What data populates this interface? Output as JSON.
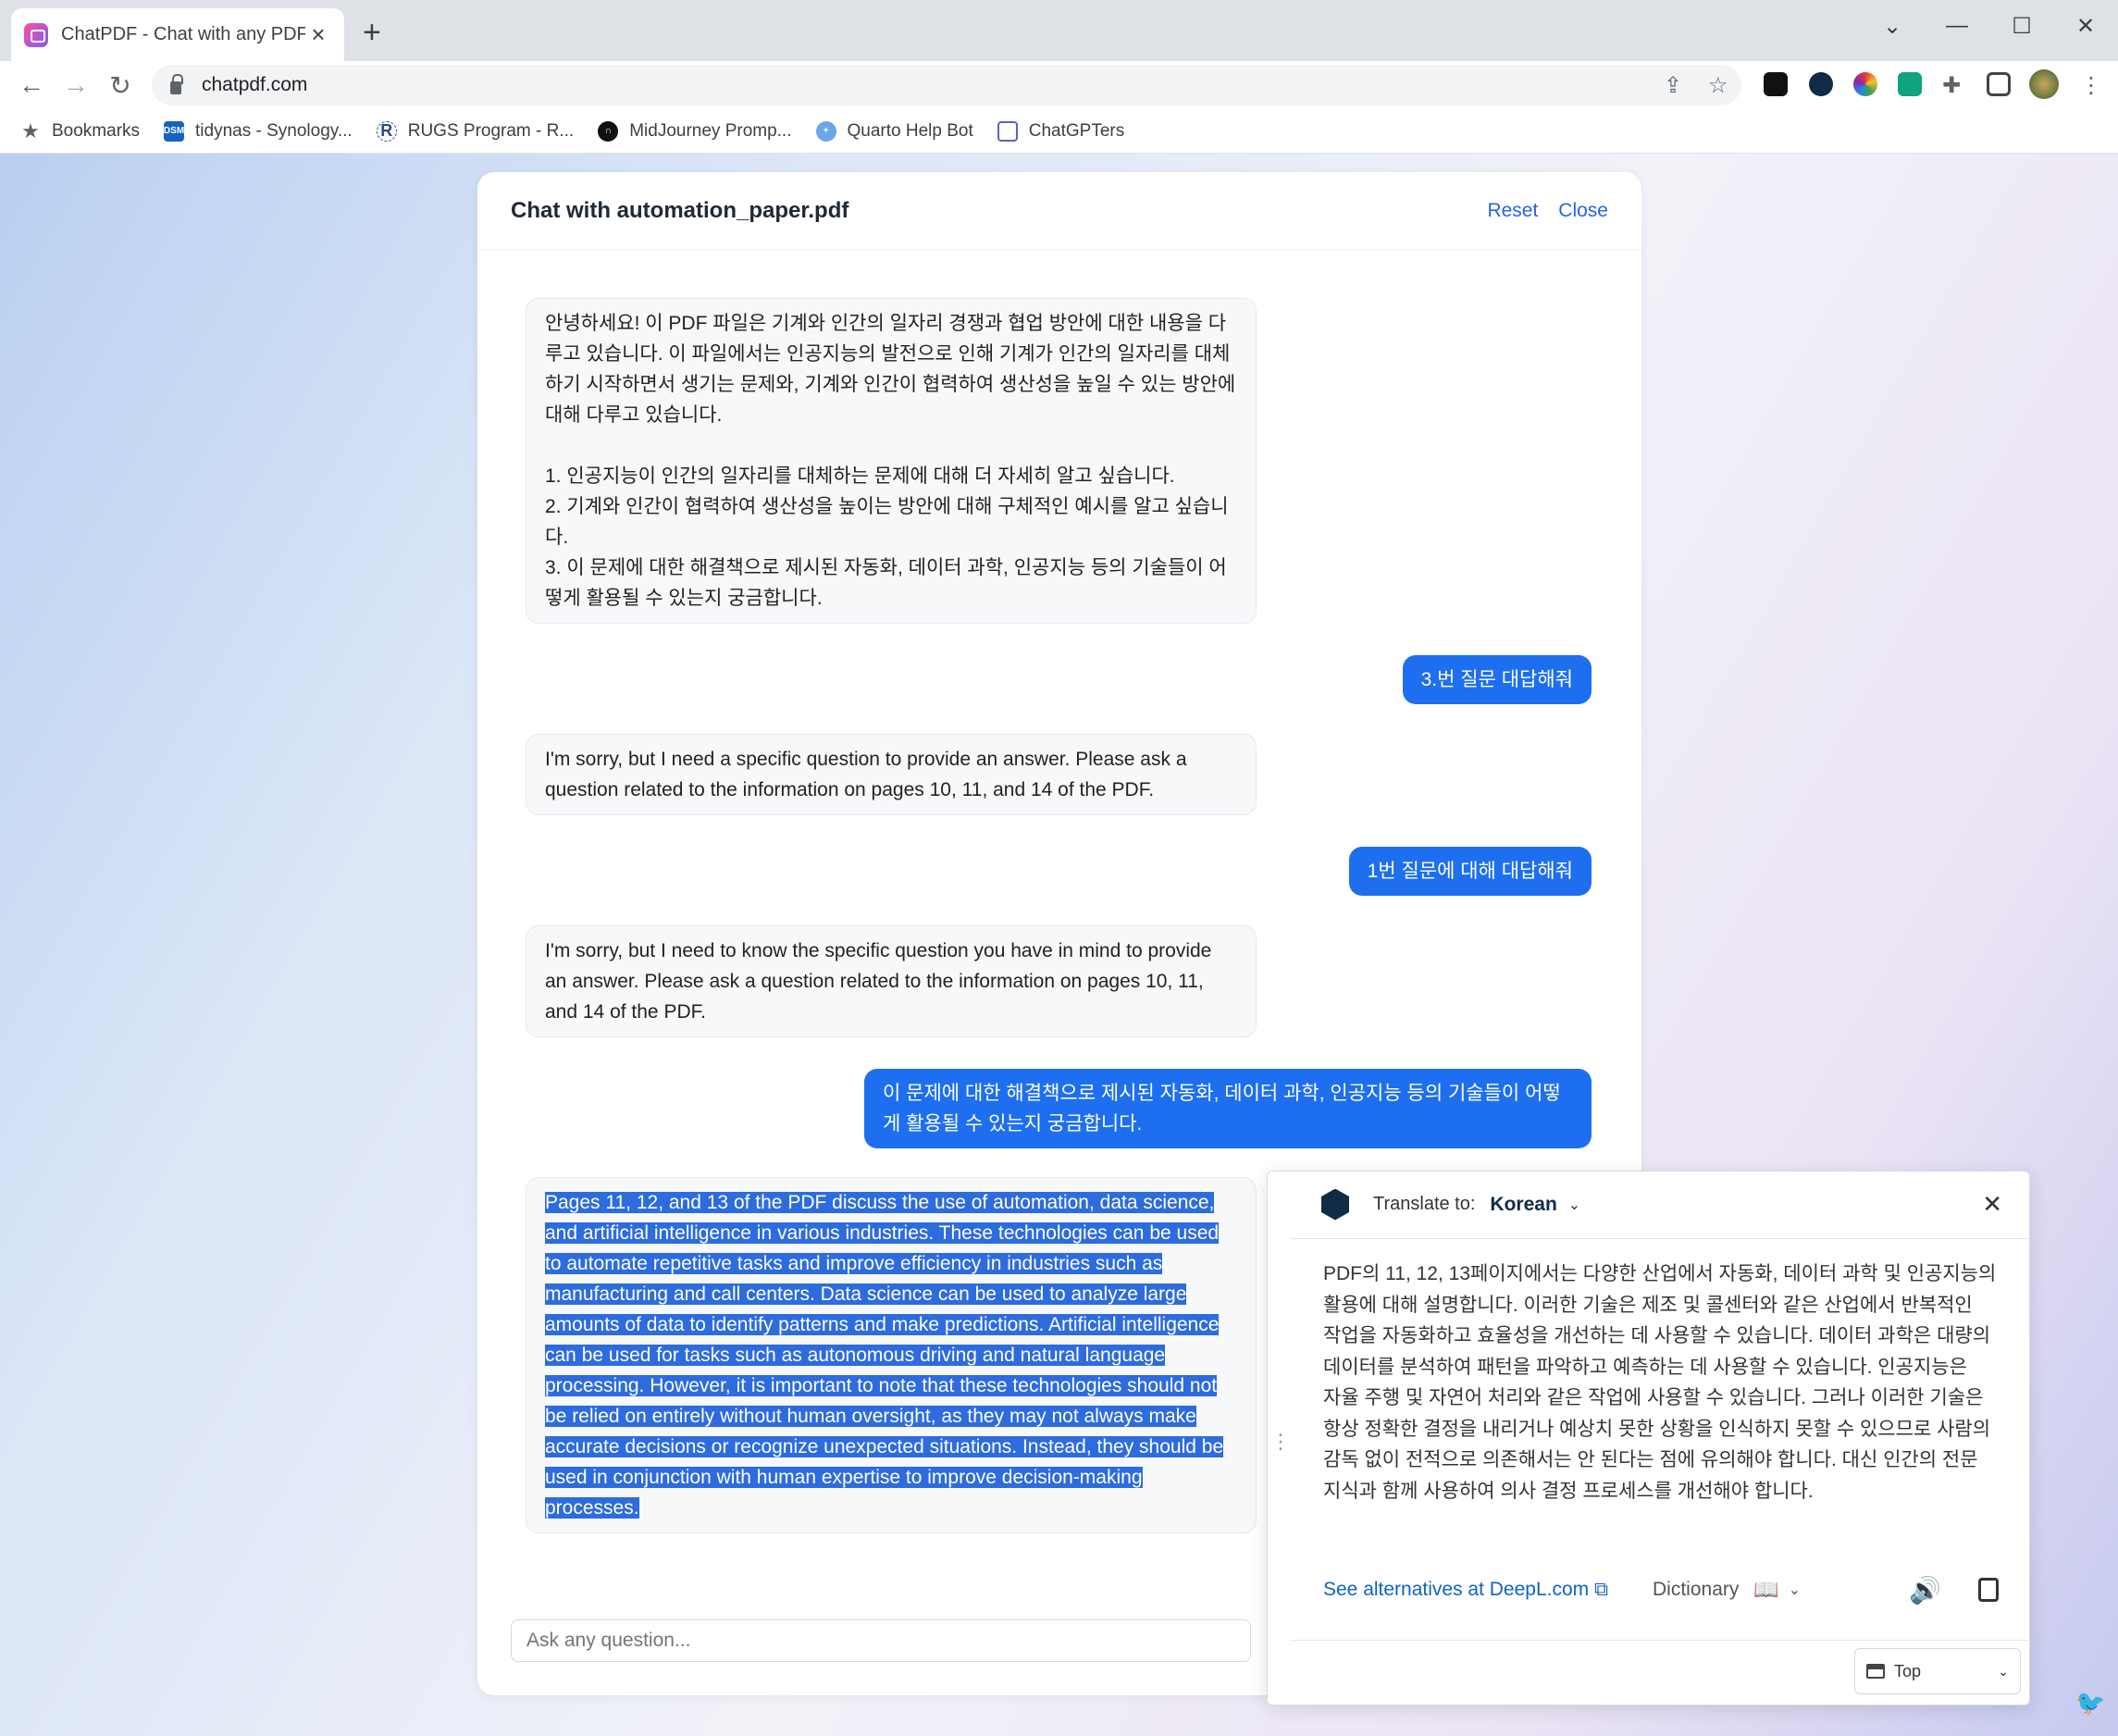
{
  "browser": {
    "tab_title": "ChatPDF - Chat with any PDF!",
    "tab_close": "×",
    "new_tab": "+",
    "window_controls": [
      "⌄",
      "—",
      "☐",
      "✕"
    ],
    "url": "chatpdf.com",
    "bookmarks": [
      {
        "label": "Bookmarks",
        "icon": "star-icon"
      },
      {
        "label": "tidynas - Synology...",
        "icon": "dsm-icon"
      },
      {
        "label": "RUGS Program - R...",
        "icon": "r-icon"
      },
      {
        "label": "MidJourney Promp...",
        "icon": "midjourney-icon"
      },
      {
        "label": "Quarto Help Bot",
        "icon": "globe-icon"
      },
      {
        "label": "ChatGPTers",
        "icon": "chatgpters-icon"
      }
    ]
  },
  "chat": {
    "title": "Chat with automation_paper.pdf",
    "reset": "Reset",
    "close": "Close",
    "messages": [
      {
        "role": "bot",
        "paragraphs": [
          "안녕하세요! 이 PDF 파일은 기계와 인간의 일자리 경쟁과 협업 방안에 대한 내용을 다루고 있습니다. 이 파일에서는 인공지능의 발전으로 인해 기계가 인간의 일자리를 대체하기 시작하면서 생기는 문제와, 기계와 인간이 협력하여 생산성을 높일 수 있는 방안에 대해 다루고 있습니다.",
          "1. 인공지능이 인간의 일자리를 대체하는 문제에 대해 더 자세히 알고 싶습니다.",
          "2. 기계와 인간이 협력하여 생산성을 높이는 방안에 대해 구체적인 예시를 알고 싶습니다.",
          "3. 이 문제에 대한 해결책으로 제시된 자동화, 데이터 과학, 인공지능 등의 기술들이 어떻게 활용될 수 있는지 궁금합니다."
        ]
      },
      {
        "role": "user",
        "text": "3.번 질문 대답해줘"
      },
      {
        "role": "bot",
        "text": "I'm sorry, but I need a specific question to provide an answer. Please ask a question related to the information on pages 10, 11, and 14 of the PDF."
      },
      {
        "role": "user",
        "text": "1번 질문에 대해 대답해줘"
      },
      {
        "role": "bot",
        "text": "I'm sorry, but I need to know the specific question you have in mind to provide an answer. Please ask a question related to the information on pages 10, 11, and 14 of the PDF."
      },
      {
        "role": "user",
        "text": "이 문제에 대한 해결책으로 제시된 자동화, 데이터 과학, 인공지능 등의 기술들이 어떻게 활용될 수 있는지 궁금합니다."
      },
      {
        "role": "bot",
        "text": "Pages 11, 12, and 13 of the PDF discuss the use of automation, data science, and artificial intelligence in various industries. These technologies can be used to automate repetitive tasks and improve efficiency in industries such as manufacturing and call centers. Data science can be used to analyze large amounts of data to identify patterns and make predictions. Artificial intelligence can be used for tasks such as autonomous driving and natural language processing. However, it is important to note that these technologies should not be relied on entirely without human oversight, as they may not always make accurate decisions or recognize unexpected situations. Instead, they should be used in conjunction with human expertise to improve decision-making processes."
      }
    ],
    "input_placeholder": "Ask any question..."
  },
  "deepl": {
    "translate_to_label": "Translate to:",
    "language": "Korean",
    "translation": "PDF의 11, 12, 13페이지에서는 다양한 산업에서 자동화, 데이터 과학 및 인공지능의 활용에 대해 설명합니다. 이러한 기술은 제조 및 콜센터와 같은 산업에서 반복적인 작업을 자동화하고 효율성을 개선하는 데 사용할 수 있습니다. 데이터 과학은 대량의 데이터를 분석하여 패턴을 파악하고 예측하는 데 사용할 수 있습니다. 인공지능은 자율 주행 및 자연어 처리와 같은 작업에 사용할 수 있습니다. 그러나 이러한 기술은 항상 정확한 결정을 내리거나 예상치 못한 상황을 인식하지 못할 수 있으므로 사람의 감독 없이 전적으로 의존해서는 안 된다는 점에 유의해야 합니다. 대신 인간의 전문 지식과 함께 사용하여 의사 결정 프로세스를 개선해야 합니다.",
    "alternatives_link": "See alternatives at DeepL.com",
    "dictionary": "Dictionary",
    "position_select": "Top"
  },
  "colors": {
    "accent": "#1d6ff0",
    "selection": "#2d6cde",
    "link": "#2563eb",
    "deepl_navy": "#0f2b46"
  }
}
